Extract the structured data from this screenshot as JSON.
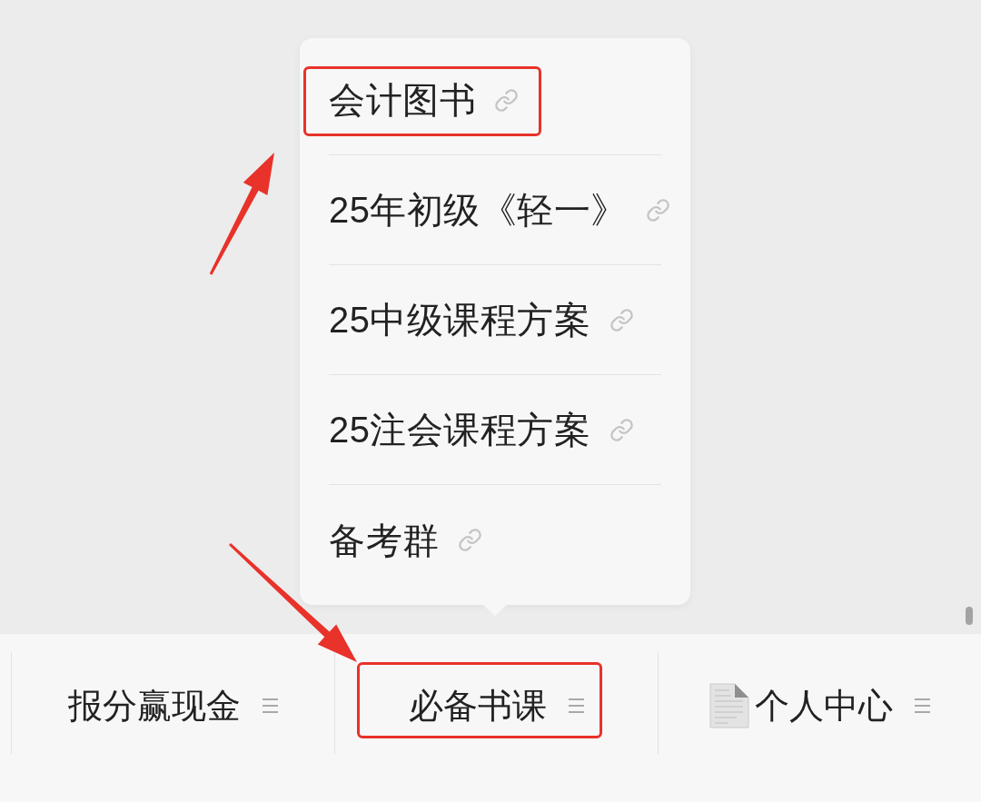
{
  "menu": {
    "items": [
      {
        "label": "会计图书",
        "highlighted": true
      },
      {
        "label": "25年初级《轻一》",
        "highlighted": false
      },
      {
        "label": "25中级课程方案",
        "highlighted": false
      },
      {
        "label": "25注会课程方案",
        "highlighted": false
      },
      {
        "label": "备考群",
        "highlighted": false
      }
    ]
  },
  "tab_bar": {
    "tabs": [
      {
        "label": "报分赢现金",
        "kind": "plain",
        "highlighted": false
      },
      {
        "label": "必备书课",
        "kind": "plain",
        "highlighted": true
      },
      {
        "label": "个人中心",
        "kind": "document",
        "highlighted": false
      }
    ]
  }
}
